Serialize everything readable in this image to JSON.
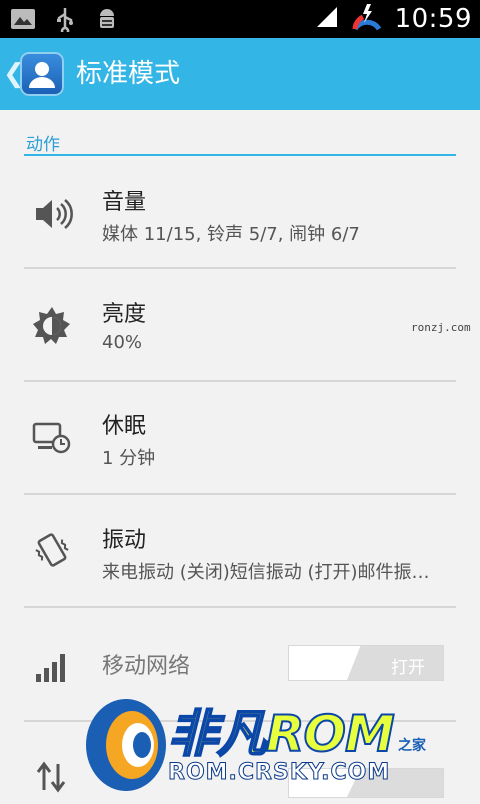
{
  "status_bar": {
    "time": "10:59"
  },
  "action_bar": {
    "title": "标准模式",
    "back_glyph": "❮"
  },
  "section": {
    "header": "动作"
  },
  "items": [
    {
      "title": "音量",
      "subtitle": "媒体 11/15, 铃声 5/7, 闹钟 6/7",
      "icon": "speaker-icon"
    },
    {
      "title": "亮度",
      "subtitle": "40%",
      "icon": "brightness-icon"
    },
    {
      "title": "休眠",
      "subtitle": "1 分钟",
      "icon": "sleep-timer-icon"
    },
    {
      "title": "振动",
      "subtitle": "来电振动 (关闭)短信振动 (打开)邮件振…",
      "icon": "vibrate-icon"
    },
    {
      "title": "移动网络",
      "toggle_label": "打开",
      "icon": "signal-bars-icon"
    }
  ],
  "watermark": "ronzj.com",
  "overlay_logo": {
    "main": "非凡ROM",
    "url": "ROM.CRSKY.COM",
    "tag": "之家"
  }
}
